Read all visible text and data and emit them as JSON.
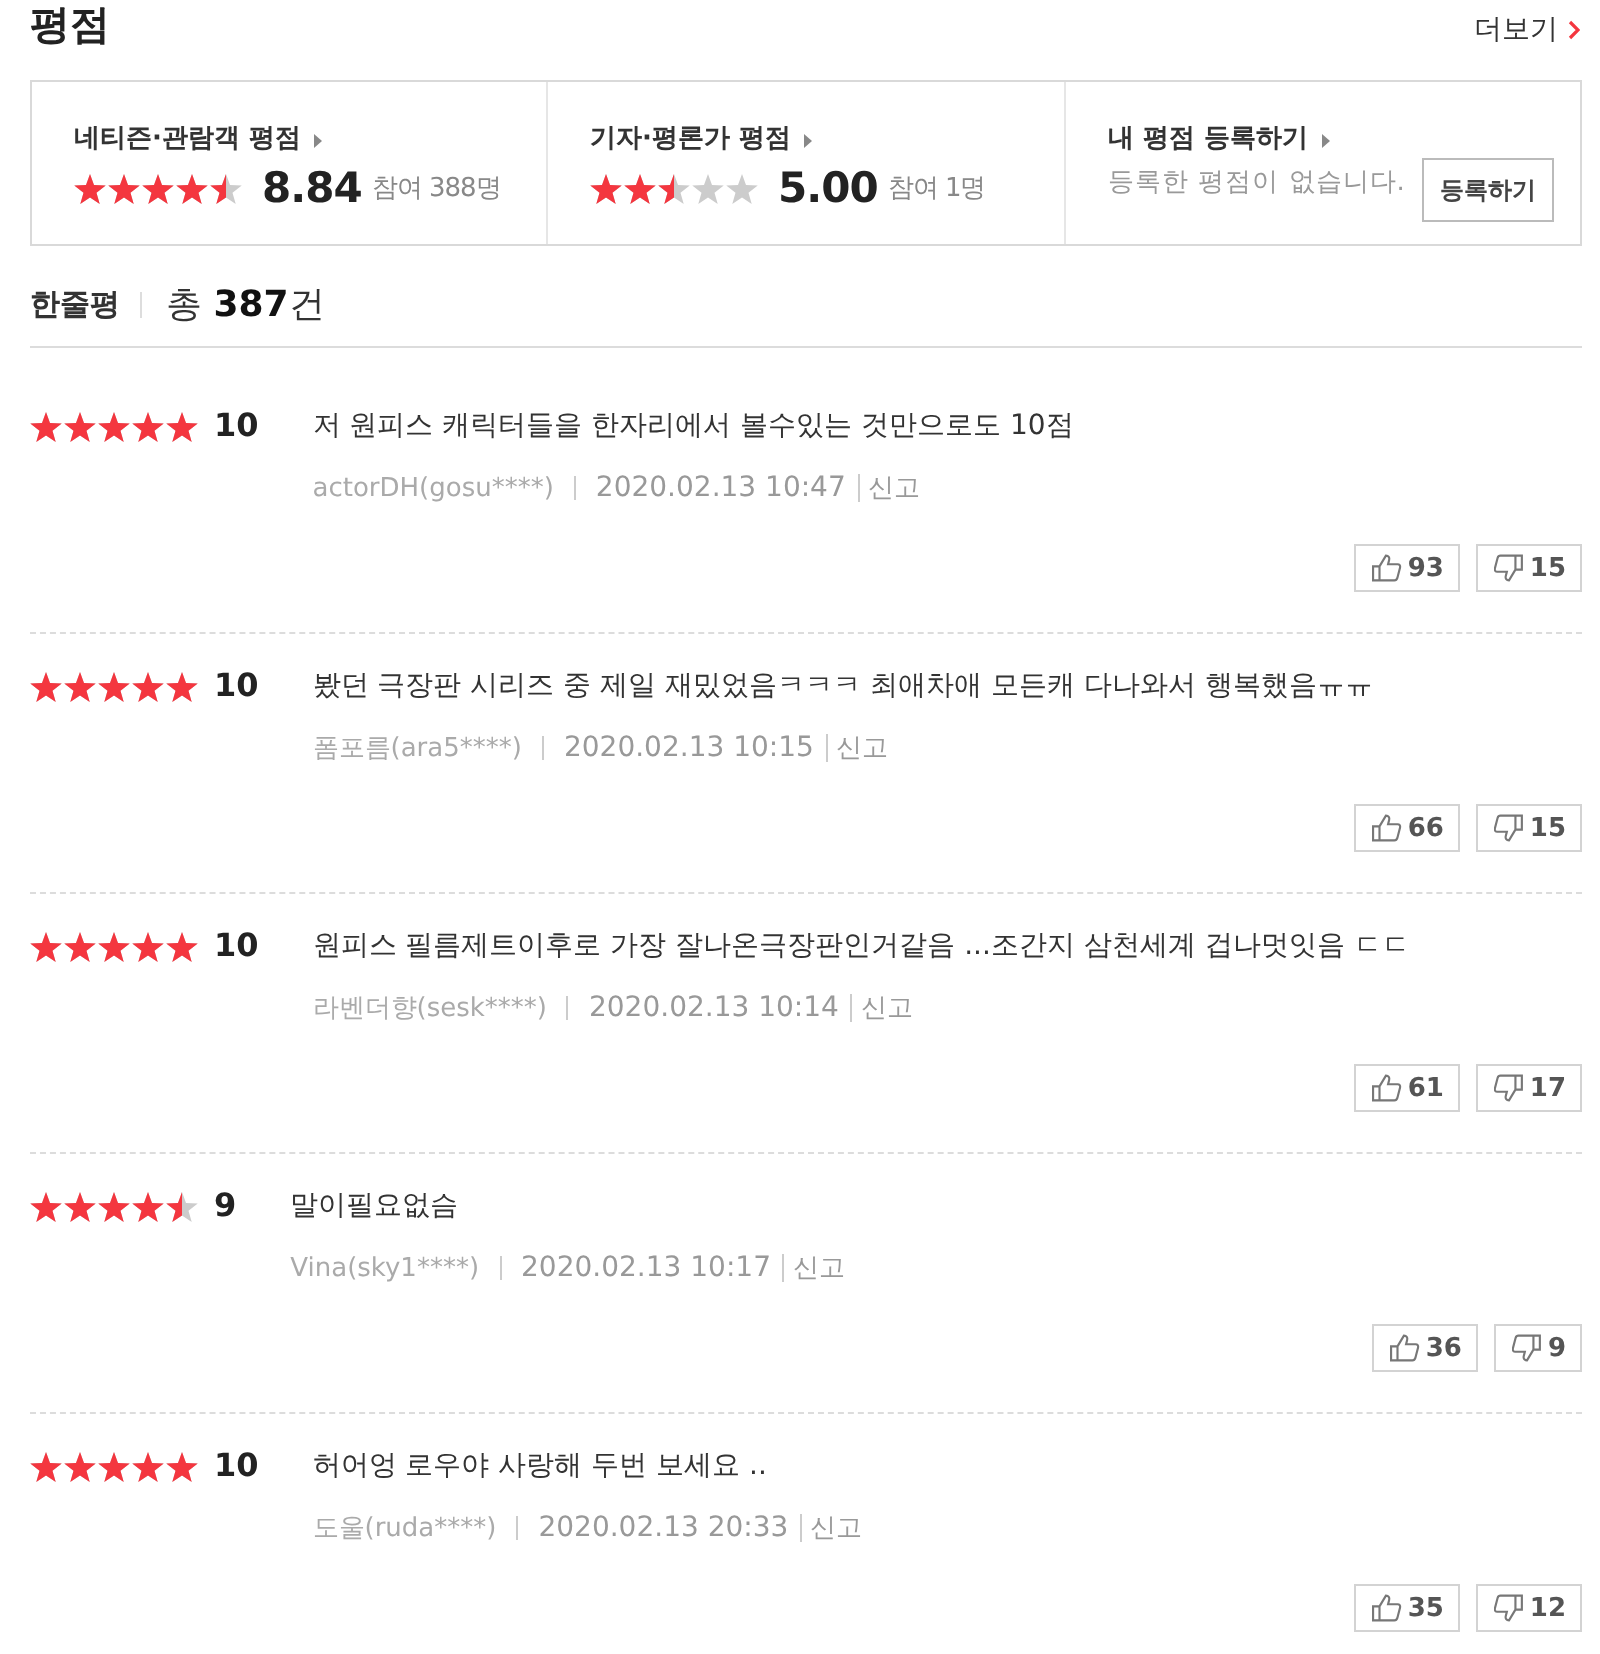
{
  "section_title": "평점",
  "more_link": "더보기",
  "rating_panels": [
    {
      "kind": "score",
      "title": "네티즌·관람객 평점",
      "stars": 4.5,
      "score": "8.84",
      "participants": "참여 388명"
    },
    {
      "kind": "score",
      "title": "기자·평론가 평점",
      "stars": 2.5,
      "score": "5.00",
      "participants": "참여 1명"
    },
    {
      "kind": "register",
      "title": "내 평점 등록하기",
      "message": "등록한 평점이 없습니다.",
      "button": "등록하기"
    }
  ],
  "reviews_header": {
    "title": "한줄평",
    "count": "총 **387**건"
  },
  "reviews": [
    {
      "stars": 5,
      "score": "10",
      "text": "저 원피스 캐릭터들을 한자리에서 볼수있는 것만으로도 10점",
      "author": "actorDH(gosu****)",
      "datetime": "2020.02.13 10:47",
      "report": "신고",
      "likes": "93",
      "dislikes": "15"
    },
    {
      "stars": 5,
      "score": "10",
      "text": "봤던 극장판 시리즈 중 제일 재밌었음ㅋㅋㅋ 최애차애 모든캐 다나와서 행복했음ㅠㅠ",
      "author": "폼포름(ara5****)",
      "datetime": "2020.02.13 10:15",
      "report": "신고",
      "likes": "66",
      "dislikes": "15"
    },
    {
      "stars": 5,
      "score": "10",
      "text": "원피스 필름제트이후로 가장 잘나온극장판인거같음 ...조간지 삼천세계 겁나멋잇음 ㄷㄷ",
      "author": "라벤더향(sesk****)",
      "datetime": "2020.02.13 10:14",
      "report": "신고",
      "likes": "61",
      "dislikes": "17"
    },
    {
      "stars": 4.5,
      "score": "9",
      "text": "말이필요없슴",
      "author": "Vina(sky1****)",
      "datetime": "2020.02.13 10:17",
      "report": "신고",
      "likes": "36",
      "dislikes": "9"
    },
    {
      "stars": 5,
      "score": "10",
      "text": "허어엉 로우야 사랑해 두번 보세요 ..",
      "author": "도울(ruda****)",
      "datetime": "2020.02.13 20:33",
      "report": "신고",
      "likes": "35",
      "dislikes": "12"
    }
  ]
}
